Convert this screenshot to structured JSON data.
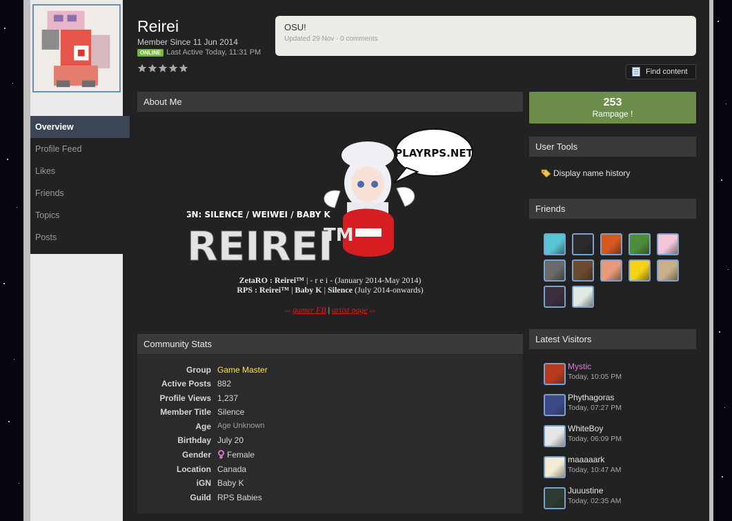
{
  "profile": {
    "name": "Reirei",
    "member_since": "Member Since 11 Jun 2014",
    "online_badge": "ONLINE",
    "last_active": "Last Active Today, 11:31 PM"
  },
  "status": {
    "text": "OSU!",
    "meta": "Updated 29 Nov · 0 comments"
  },
  "find_content": {
    "label": "Find content",
    "icon": "document-icon"
  },
  "nav": {
    "items": [
      {
        "label": "Overview"
      },
      {
        "label": "Profile Feed"
      },
      {
        "label": "Likes"
      },
      {
        "label": "Friends"
      },
      {
        "label": "Topics"
      },
      {
        "label": "Posts"
      }
    ]
  },
  "about": {
    "title": "About Me",
    "banner": {
      "bubble": "PLAYRPS.NET",
      "ign": "IGN: SILENCE / WEIWEI / BABY K",
      "logo": "REIREI",
      "tm": "TM"
    },
    "credits_line1_bold": "ZetaRO : Reirei™",
    "credits_line1_rest": " | - r e i - (January 2014-May 2014)",
    "credits_line2_bold": "RPS : Reirei™",
    "credits_line2_mid": " | ",
    "credits_line2_bold2": "Baby K",
    "credits_line2_mid2": " | ",
    "credits_line2_bold3": "Silence",
    "credits_line2_rest": " (July 2014-onwards)",
    "link_arrows_left": "»»",
    "link1": "gamer FB",
    "link_sep": "|",
    "link2": "artist page",
    "link_arrows_right": "««"
  },
  "community_stats": {
    "title": "Community Stats",
    "rows": [
      {
        "label": "Group",
        "value": "Game Master"
      },
      {
        "label": "Active Posts",
        "value": "882"
      },
      {
        "label": "Profile Views",
        "value": "1,237"
      },
      {
        "label": "Member Title",
        "value": "Silence"
      },
      {
        "label": "Age",
        "value": "Age Unknown"
      },
      {
        "label": "Birthday",
        "value": "July 20"
      },
      {
        "label": "Gender",
        "value": "Female"
      },
      {
        "label": "Location",
        "value": "Canada"
      },
      {
        "label": "iGN",
        "value": "Baby K"
      },
      {
        "label": "Guild",
        "value": "RPS Babies"
      }
    ]
  },
  "rampage": {
    "count": "253",
    "label": "Rampage !"
  },
  "user_tools": {
    "title": "User Tools",
    "item": "Display name history"
  },
  "friends": {
    "title": "Friends",
    "colors": [
      "#5bc5d8",
      "#2a2a2a",
      "#d4581f",
      "#4e8d3a",
      "#f2c6d6",
      "#6a6a6a",
      "#6b4a30",
      "#e89a7a",
      "#f4d417",
      "#c9b08a",
      "#3a3040",
      "#dfe9e3"
    ]
  },
  "latest_visitors": {
    "title": "Latest Visitors",
    "items": [
      {
        "name": "Mystic",
        "time": "Today, 10:05 PM",
        "color": "#b83a1e"
      },
      {
        "name": "Phythagoras",
        "time": "Today, 07:27 PM",
        "color": "#3d4a8a"
      },
      {
        "name": "WhiteBoy",
        "time": "Today, 06:09 PM",
        "color": "#e6e6e6"
      },
      {
        "name": "maaaaark",
        "time": "Today, 10:47 AM",
        "color": "#f3ecd0"
      },
      {
        "name": "Juuustine",
        "time": "Today, 02:35 AM",
        "color": "#2f3a32"
      }
    ]
  }
}
